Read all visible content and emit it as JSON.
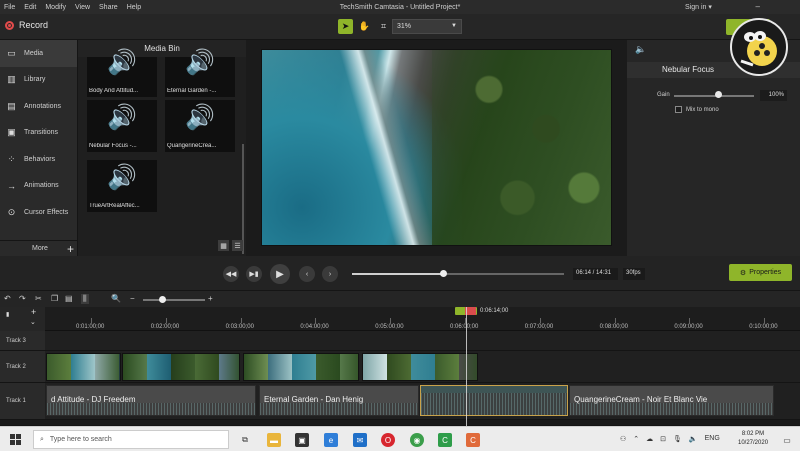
{
  "window": {
    "title": "TechSmith Camtasia - Untitled Project*",
    "menu": [
      "File",
      "Edit",
      "Modify",
      "View",
      "Share",
      "Help"
    ],
    "sign_in": "Sign in ▾"
  },
  "toolbar": {
    "record_label": "Record",
    "zoom": "31%"
  },
  "left_nav": {
    "items": [
      {
        "label": "Media",
        "icon": "media-icon"
      },
      {
        "label": "Library",
        "icon": "library-icon"
      },
      {
        "label": "Annotations",
        "icon": "annotations-icon"
      },
      {
        "label": "Transitions",
        "icon": "transitions-icon"
      },
      {
        "label": "Behaviors",
        "icon": "behaviors-icon"
      },
      {
        "label": "Animations",
        "icon": "animations-icon"
      },
      {
        "label": "Cursor Effects",
        "icon": "cursor-effects-icon"
      }
    ],
    "more_label": "More"
  },
  "media_bin": {
    "title": "Media Bin",
    "items": [
      "Body And Attitud...",
      "Eternal Garden -...",
      "Nebular Focus -...",
      "QuangerineCrea...",
      "TrueArtRealAffec..."
    ]
  },
  "properties": {
    "header": "Nebular Focus",
    "gain_label": "Gain",
    "gain_value": "100%",
    "gain_level": 0.55,
    "mix_to_mono_label": "Mix to mono",
    "properties_button": "Properties"
  },
  "playback": {
    "time": "06:14 / 14:31",
    "fps": "30fps",
    "progress": 0.43
  },
  "timeline": {
    "playhead_time": "0:06:14;00",
    "ruler_ticks": [
      "0:01:00;00",
      "0:02:00;00",
      "0:03:00;00",
      "0:04:00;00",
      "0:05:00;00",
      "0:06:00;00",
      "0:07:00;00",
      "0:08:00;00",
      "0:09:00;00",
      "0:10:00;00"
    ],
    "tracks": [
      {
        "label": "Track 3"
      },
      {
        "label": "Track 2"
      },
      {
        "label": "Track 1"
      }
    ],
    "audio_clips": [
      "d Attitude - DJ Freedem",
      "Eternal Garden - Dan Henig",
      "QuangerineCream - Noir Et Blanc Vie"
    ]
  },
  "taskbar": {
    "search_placeholder": "Type here to search",
    "language": "ENG",
    "time": "8:02 PM",
    "date": "10/27/2020"
  },
  "colors": {
    "accent": "#8fb52a",
    "record": "#e24b4b",
    "playhead_red": "#d94c4c",
    "clip_selected_border": "#c9a24a"
  }
}
